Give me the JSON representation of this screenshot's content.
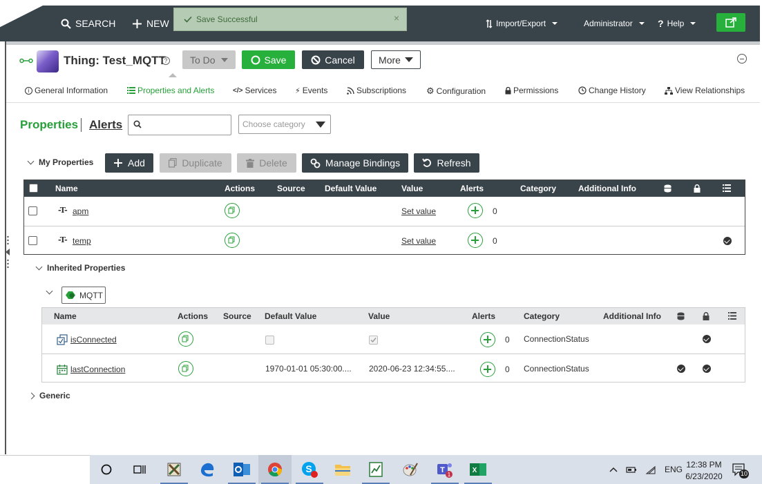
{
  "nav": {
    "search_label": "SEARCH",
    "new_label": "NEW",
    "import_export": "Import/Export",
    "user": "Administrator",
    "help": "Help"
  },
  "toast": {
    "message": "Save Successful",
    "close": "×"
  },
  "entity": {
    "title": "Thing: Test_MQTT",
    "help": "?",
    "state": "To Do",
    "save": "Save",
    "cancel": "Cancel",
    "more": "More"
  },
  "tabs": [
    {
      "label": "General Information"
    },
    {
      "label": "Properties and Alerts"
    },
    {
      "label": "Services"
    },
    {
      "label": "Events"
    },
    {
      "label": "Subscriptions"
    },
    {
      "label": "Configuration"
    },
    {
      "label": "Permissions"
    },
    {
      "label": "Change History"
    },
    {
      "label": "View Relationships"
    }
  ],
  "subtabs": {
    "properties": "Properties",
    "alerts": "Alerts"
  },
  "filters": {
    "search_placeholder": "",
    "category_placeholder": "Choose category"
  },
  "my_properties": {
    "title": "My Properties",
    "buttons": {
      "add": "Add",
      "duplicate": "Duplicate",
      "delete": "Delete",
      "manage_bindings": "Manage Bindings",
      "refresh": "Refresh"
    },
    "columns": [
      "Name",
      "Actions",
      "Source",
      "Default Value",
      "Value",
      "Alerts",
      "Category",
      "Additional Info"
    ],
    "rows": [
      {
        "name": "apm",
        "value": "Set value",
        "alerts": "0",
        "readonly": false
      },
      {
        "name": "temp",
        "value": "Set value",
        "alerts": "0",
        "readonly": true
      }
    ]
  },
  "inherited": {
    "title": "Inherited Properties",
    "group": "MQTT",
    "columns": [
      "Name",
      "Actions",
      "Source",
      "Default Value",
      "Value",
      "Alerts",
      "Category",
      "Additional Info"
    ],
    "rows": [
      {
        "name": "isConnected",
        "default_value": "",
        "value": "",
        "alerts": "0",
        "category": "ConnectionStatus"
      },
      {
        "name": "lastConnection",
        "default_value": "1970-01-01 05:30:00....",
        "value": "2020-06-23 12:34:55....",
        "alerts": "0",
        "category": "ConnectionStatus"
      }
    ]
  },
  "generic": {
    "title": "Generic"
  },
  "taskbar": {
    "language": "ENG",
    "time": "12:38 PM",
    "date": "6/23/2020",
    "notifications": "10"
  },
  "colors": {
    "accent": "#27b03c",
    "dark": "#39434a",
    "toast": "#b6cbb3"
  }
}
